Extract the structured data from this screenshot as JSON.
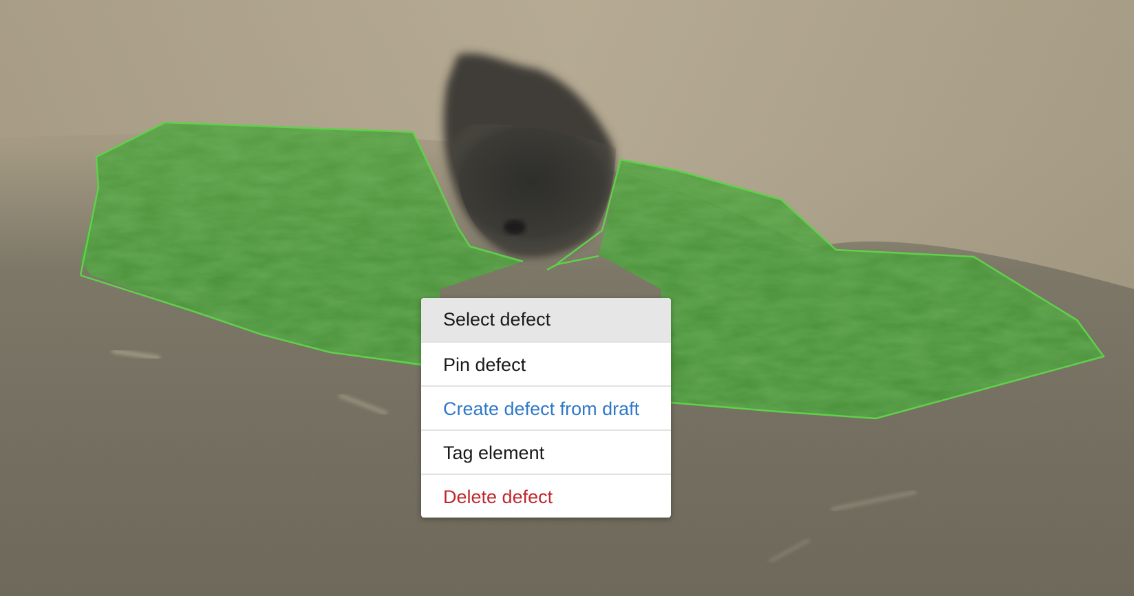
{
  "menu": {
    "items": [
      {
        "label": "Select defect",
        "style": "default",
        "highlighted": true
      },
      {
        "label": "Pin defect",
        "style": "default"
      },
      {
        "label": "Create defect from draft",
        "style": "primary",
        "color": "#2f78c8"
      },
      {
        "label": "Tag element",
        "style": "default"
      },
      {
        "label": "Delete defect",
        "style": "danger",
        "color": "#c0282d"
      }
    ]
  },
  "overlay": {
    "defect_color": "#5fd14a",
    "defect_fill": "#3aa62a"
  }
}
